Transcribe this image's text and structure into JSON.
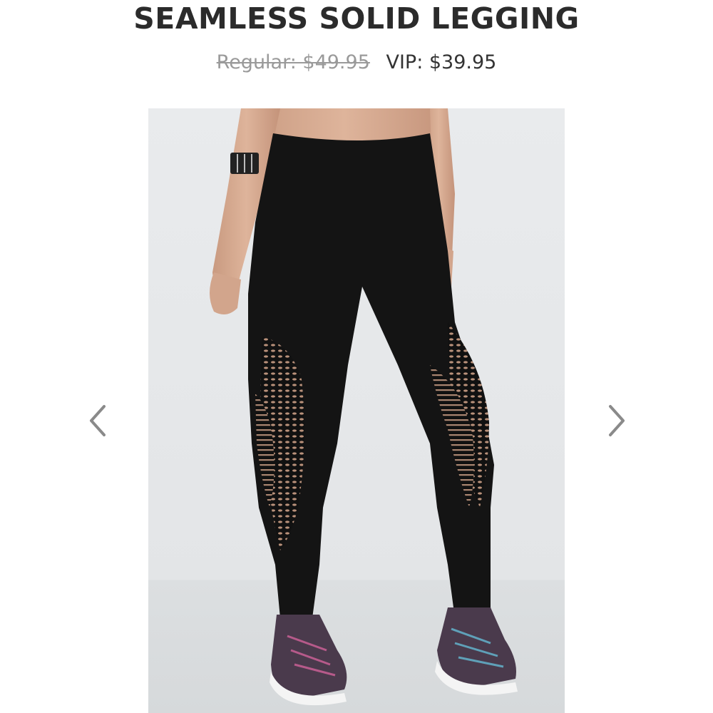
{
  "product": {
    "title": "SEAMLESS SOLID LEGGING",
    "regular_price": "Regular: $49.95",
    "vip_price": "VIP: $39.95"
  },
  "gallery": {
    "prev_icon": "chevron-left-icon",
    "next_icon": "chevron-right-icon"
  },
  "colors": {
    "title": "#2b2b2b",
    "regular_price": "#9a9a9a",
    "vip_price": "#333333",
    "arrow": "#8a8a8a"
  }
}
